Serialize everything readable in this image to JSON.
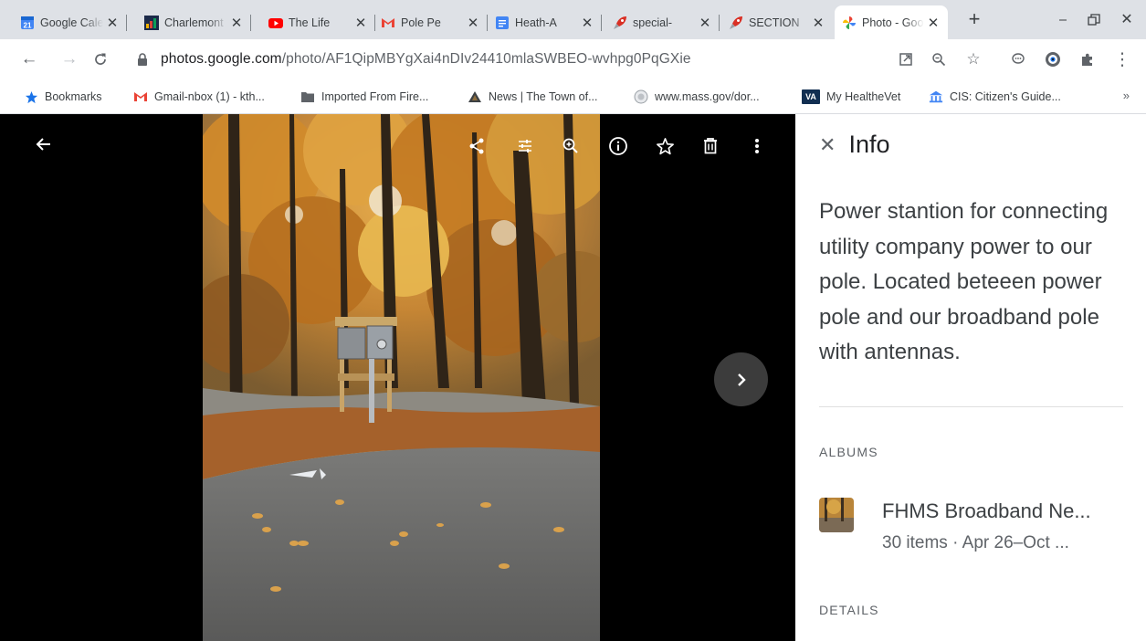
{
  "browser": {
    "tabs": [
      {
        "title": "Google Calendar",
        "icon": "calendar-icon",
        "day": "21",
        "active": false
      },
      {
        "title": "Charlemont",
        "icon": "site-favicon",
        "active": false
      },
      {
        "title": "The Life",
        "icon": "youtube-icon",
        "active": false
      },
      {
        "title": "Pole Pe",
        "icon": "gmail-icon",
        "active": false
      },
      {
        "title": "Heath-A",
        "icon": "docs-icon",
        "active": false
      },
      {
        "title": "special-",
        "icon": "rocket-icon",
        "active": false
      },
      {
        "title": "SECTION",
        "icon": "rocket-icon",
        "active": false
      },
      {
        "title": "Photo - Google",
        "icon": "photos-icon",
        "active": true
      }
    ],
    "url_host": "photos.google.com",
    "url_path": "/photo/AF1QipMBYgXai4nDIv24410mlaSWBEO-wvhpg0PqGXie",
    "bookmarks": [
      {
        "label": "Bookmarks",
        "icon": "star-icon"
      },
      {
        "label": "Gmail-nbox (1) - kth...",
        "icon": "gmail-icon"
      },
      {
        "label": "Imported From Fire...",
        "icon": "folder-icon"
      },
      {
        "label": "News | The Town of...",
        "icon": "town-icon"
      },
      {
        "label": "www.mass.gov/dor...",
        "icon": "seal-icon"
      },
      {
        "label": "My HealtheVet",
        "icon": "va-icon",
        "badge": "VA"
      },
      {
        "label": "CIS: Citizen's Guide...",
        "icon": "building-icon"
      }
    ],
    "bookmarks_more": "»"
  },
  "info": {
    "title": "Info",
    "description": "Power stantion for connecting utility company power to our pole. Located beteeen power pole and our broadband pole with antennas.",
    "albums_label": "ALBUMS",
    "album": {
      "name": "FHMS Broadband Ne...",
      "count": "30 items",
      "dates": "Apr 26–Oct ..."
    },
    "details_label": "DETAILS"
  },
  "colors": {
    "accent": "#1a73e8",
    "viewer_bg": "#000000",
    "tabstrip": "#dee1e6"
  }
}
